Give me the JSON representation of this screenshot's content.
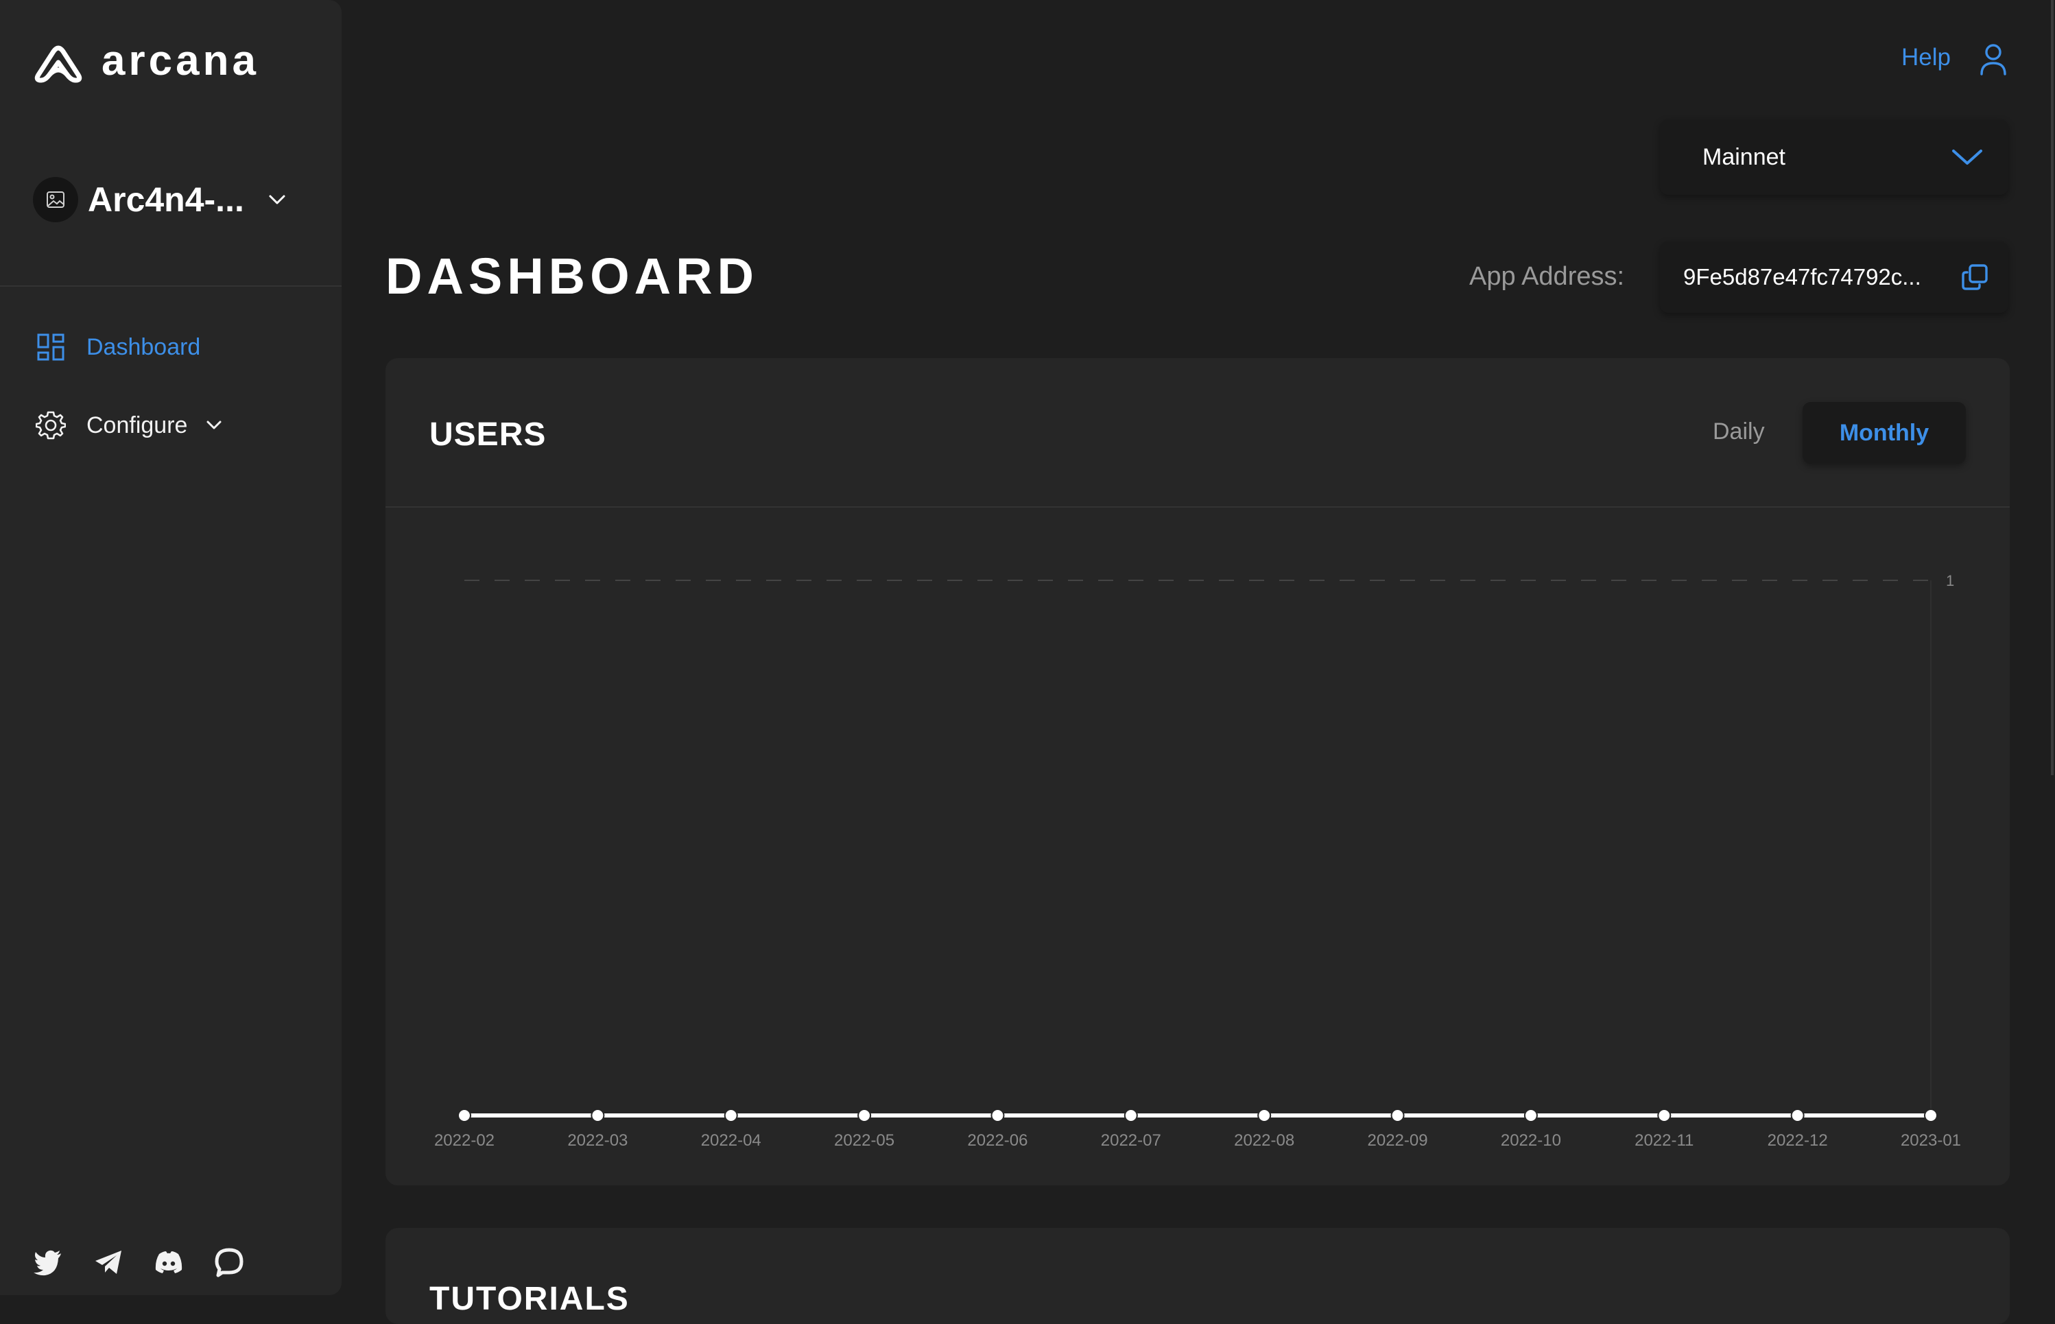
{
  "brand": {
    "name": "arcana"
  },
  "app_switcher": {
    "app_name": "Arc4n4-..."
  },
  "sidebar": {
    "items": [
      {
        "label": "Dashboard",
        "icon": "dashboard-grid-icon",
        "active": true
      },
      {
        "label": "Configure",
        "icon": "gear-icon",
        "active": false
      }
    ],
    "social_icons": [
      "twitter-icon",
      "telegram-icon",
      "discord-icon",
      "chat-icon"
    ]
  },
  "header": {
    "help_label": "Help",
    "network": {
      "selected": "Mainnet"
    }
  },
  "main": {
    "title": "DASHBOARD",
    "app_address_label": "App Address:",
    "app_address_value": "9Fe5d87e47fc74792c..."
  },
  "users_card": {
    "title": "USERS",
    "tabs": [
      {
        "label": "Daily",
        "active": false
      },
      {
        "label": "Monthly",
        "active": true
      }
    ]
  },
  "tutorials_card": {
    "title": "TUTORIALS"
  },
  "colors": {
    "accent": "#3d8fe8",
    "background": "#1e1e1e",
    "panel": "#262626",
    "muted_text": "#9a9a9a"
  },
  "chart_data": {
    "type": "line",
    "x": [
      "2022-02",
      "2022-03",
      "2022-04",
      "2022-05",
      "2022-06",
      "2022-07",
      "2022-08",
      "2022-09",
      "2022-10",
      "2022-11",
      "2022-12",
      "2023-01"
    ],
    "series": [
      {
        "values": [
          0,
          0,
          0,
          0,
          0,
          0,
          0,
          0,
          0,
          0,
          0,
          0
        ]
      }
    ],
    "y_ticks": [
      "1"
    ],
    "ylim": [
      0,
      1
    ],
    "grid": "dashed line at y=1",
    "y_axis_side": "right"
  }
}
